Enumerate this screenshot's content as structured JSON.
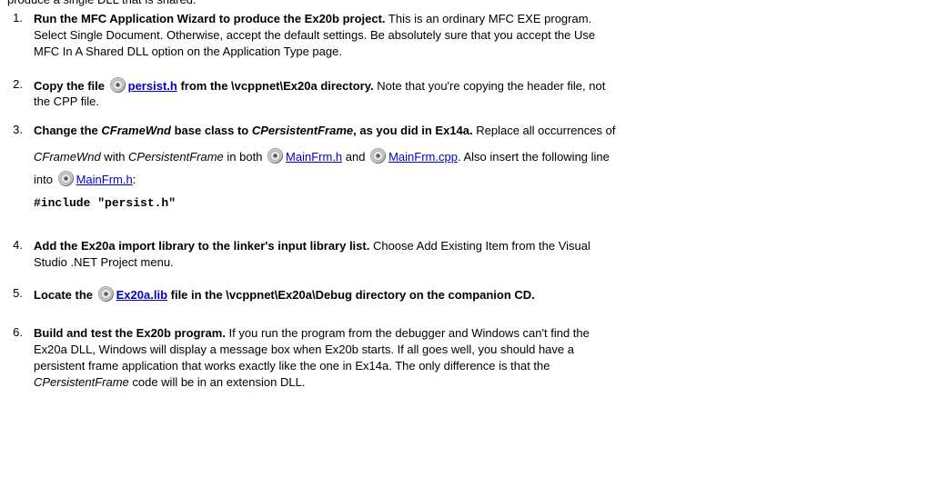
{
  "clipped_top_text": "produce a single DLL that is shared.",
  "steps": [
    {
      "num": "1.",
      "lines": [
        {
          "bold": "Run the MFC Application Wizard to produce the Ex20b project.",
          "rest": " This is an ordinary MFC EXE program."
        },
        {
          "text": "Select Single Document. Otherwise, accept the default settings. Be absolutely sure that you accept the Use"
        },
        {
          "text": "MFC In A Shared DLL option on the Application Type page."
        }
      ]
    },
    {
      "num": "2.",
      "pre": "Copy the file",
      "link": "persist.h",
      "post": " from the \\vcppnet\\Ex20a directory.",
      "rest": " Note that you're copying the header file, not",
      "cont": "the CPP file."
    },
    {
      "num": "3.",
      "bold_a": "Change the ",
      "it_a": "CFrameWnd",
      "bold_b": " base class to ",
      "it_b": "CPersistentFrame",
      "bold_c": ", as you did in Ex14a.",
      "rest": " Replace all occurrences of",
      "l2_it_a": "CFrameWnd",
      "l2_mid": " with ",
      "l2_it_b": "CPersistentFrame",
      "l2_in": " in both ",
      "link_h": "MainFrm.h",
      "l2_and": " and ",
      "link_cpp": "MainFrm.cpp",
      "l2_end": ". Also insert the following line",
      "l3_into": "into ",
      "link_h2": "MainFrm.h",
      "l3_colon": ":",
      "code": "#include \"persist.h\""
    },
    {
      "num": "4.",
      "bold": "Add the Ex20a import library to the linker's input library list.",
      "rest": " Choose Add Existing Item from the Visual",
      "cont": "Studio .NET Project menu."
    },
    {
      "num": "5.",
      "pre": "Locate the",
      "link": "Ex20a.lib",
      "post": " file in the \\vcppnet\\Ex20a\\Debug directory on the companion CD."
    },
    {
      "num": "6.",
      "bold": "Build and test the Ex20b program.",
      "rest": " If you run the program from the debugger and Windows can't find the",
      "l2": "Ex20a DLL, Windows will display a message box when Ex20b starts. If all goes well, you should have a",
      "l3": "persistent frame application that works exactly like the one in Ex14a. The only difference is that the",
      "l4_it": "CPersistentFrame",
      "l4_rest": " code will be in an extension DLL."
    }
  ]
}
